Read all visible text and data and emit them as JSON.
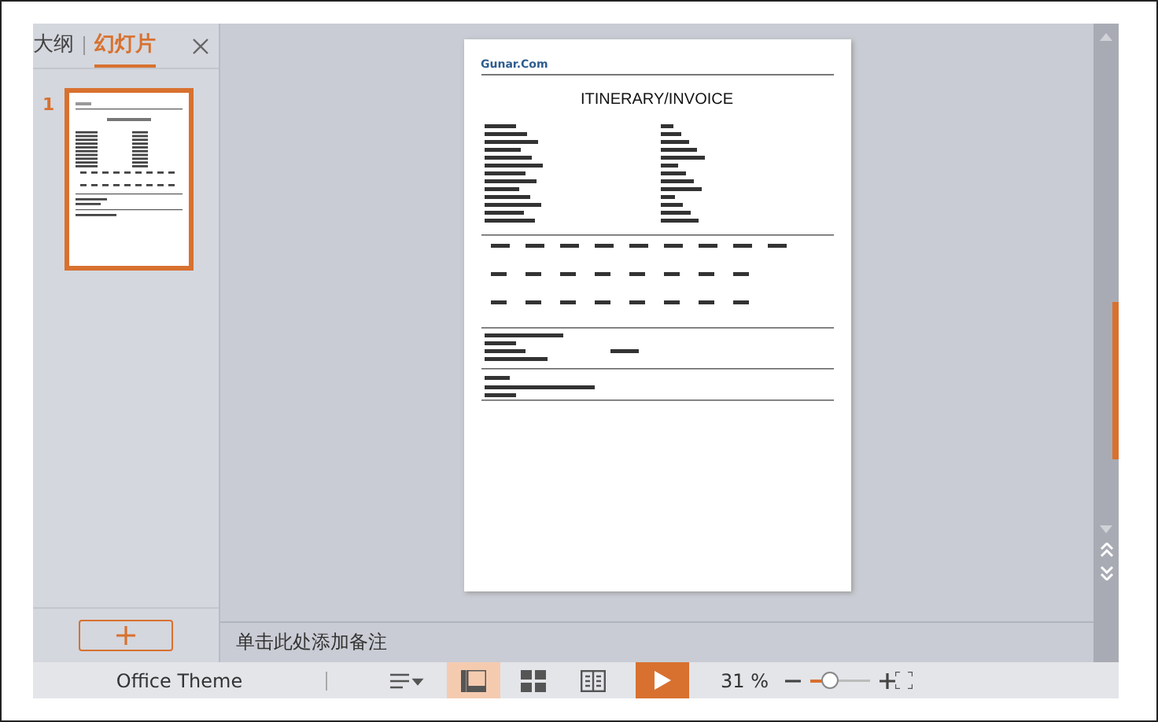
{
  "panel_tabs": [
    {
      "label": "大纲",
      "selected": false
    },
    {
      "label": "幻灯片",
      "selected": true
    }
  ],
  "slides": [
    {
      "number": "1",
      "selected": true
    }
  ],
  "slide": {
    "logo": "Gunar.Com",
    "title": "ITINERARY/INVOICE"
  },
  "notes": {
    "placeholder": "单击此处添加备注"
  },
  "status_bar": {
    "theme": "Office Theme",
    "views": [
      {
        "kind": "normal",
        "selected": true
      },
      {
        "kind": "sorter",
        "selected": false
      },
      {
        "kind": "reading",
        "selected": false
      }
    ],
    "zoom": "31 %",
    "zoom_level": {
      "level": 0.35
    }
  }
}
